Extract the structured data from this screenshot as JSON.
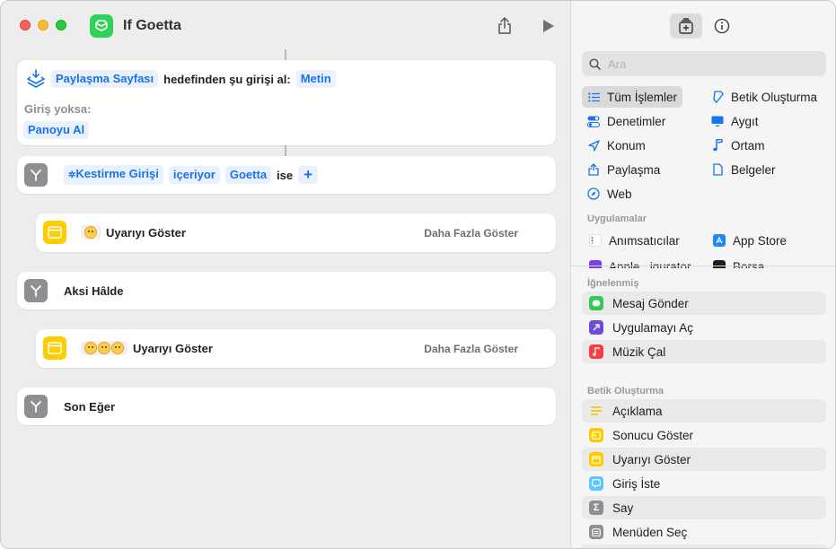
{
  "window": {
    "title": "If Goetta"
  },
  "workflow": {
    "receive": {
      "source": "Paylaşma Sayfası",
      "text": "hedefinden şu girişi al:",
      "type": "Metin",
      "fallback_label": "Giriş yoksa:",
      "fallback_action": "Panoyu Al"
    },
    "if_block": {
      "input": "Kestirme Girişi",
      "condition": "içeriyor",
      "value": "Goetta",
      "suffix": "ise",
      "add": "+"
    },
    "alert1": {
      "title": "Uyarıyı Göster",
      "more": "Daha Fazla Göster"
    },
    "otherwise": {
      "label": "Aksi Hâlde"
    },
    "alert2": {
      "title": "Uyarıyı Göster",
      "more": "Daha Fazla Göster"
    },
    "end_if": {
      "label": "Son Eğer"
    }
  },
  "sidebar": {
    "search_placeholder": "Ara",
    "categories": [
      {
        "label": "Tüm İşlemler",
        "icon": "list-icon"
      },
      {
        "label": "Betik Oluşturma",
        "icon": "script-icon"
      },
      {
        "label": "Denetimler",
        "icon": "toggles-icon"
      },
      {
        "label": "Aygıt",
        "icon": "display-icon"
      },
      {
        "label": "Konum",
        "icon": "location-icon"
      },
      {
        "label": "Ortam",
        "icon": "music-note-icon"
      },
      {
        "label": "Paylaşma",
        "icon": "share-icon"
      },
      {
        "label": "Belgeler",
        "icon": "document-icon"
      },
      {
        "label": "Web",
        "icon": "compass-icon"
      }
    ],
    "apps_title": "Uygulamalar",
    "apps": [
      {
        "label": "Anımsatıcılar",
        "icon": "reminders-icon"
      },
      {
        "label": "App Store",
        "icon": "app-store-icon"
      },
      {
        "label": "Apple...igurator",
        "icon": "configurator-icon"
      },
      {
        "label": "Borsa",
        "icon": "stocks-icon"
      }
    ],
    "pinned_title": "İğnelenmiş",
    "pinned": [
      {
        "label": "Mesaj Gönder",
        "color": "#34c759"
      },
      {
        "label": "Uygulamayı Aç",
        "color": "#6e4bd8"
      },
      {
        "label": "Müzik Çal",
        "color": "#fc3c44"
      }
    ],
    "scripting_title": "Betik Oluşturma",
    "scripting": [
      {
        "label": "Açıklama",
        "color": "#ffd84d"
      },
      {
        "label": "Sonucu Göster",
        "color": "#ffcc00"
      },
      {
        "label": "Uyarıyı Göster",
        "color": "#ffcc00"
      },
      {
        "label": "Giriş İste",
        "color": "#5ac8fa"
      },
      {
        "label": "Say",
        "color": "#8e8e93"
      },
      {
        "label": "Menüden Seç",
        "color": "#8e8e93"
      }
    ]
  }
}
